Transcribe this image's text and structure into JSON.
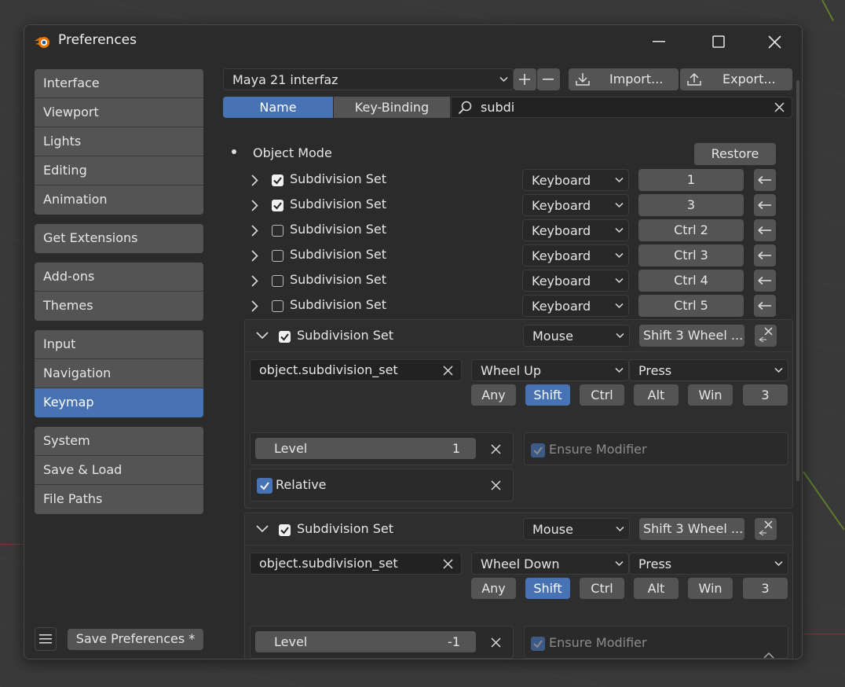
{
  "window": {
    "title": "Preferences"
  },
  "sidebar": {
    "groups": [
      [
        "Interface",
        "Viewport",
        "Lights",
        "Editing",
        "Animation"
      ],
      [
        "Get Extensions"
      ],
      [
        "Add-ons",
        "Themes"
      ],
      [
        "Input",
        "Navigation",
        "Keymap"
      ],
      [
        "System",
        "Save & Load",
        "File Paths"
      ]
    ],
    "active": "Keymap"
  },
  "footer": {
    "save_label": "Save Preferences *"
  },
  "keymap": {
    "preset": "Maya 21 interfaz",
    "import_label": "Import...",
    "export_label": "Export...",
    "tab_name": "Name",
    "tab_keybinding": "Key-Binding",
    "search_value": "subdi",
    "section": "Object Mode",
    "restore_label": "Restore",
    "rows": [
      {
        "name": "Subdivision Set",
        "checked": true,
        "type": "Keyboard",
        "key": "1"
      },
      {
        "name": "Subdivision Set",
        "checked": true,
        "type": "Keyboard",
        "key": "3"
      },
      {
        "name": "Subdivision Set",
        "checked": false,
        "type": "Keyboard",
        "key": "Ctrl 2"
      },
      {
        "name": "Subdivision Set",
        "checked": false,
        "type": "Keyboard",
        "key": "Ctrl 3"
      },
      {
        "name": "Subdivision Set",
        "checked": false,
        "type": "Keyboard",
        "key": "Ctrl 4"
      },
      {
        "name": "Subdivision Set",
        "checked": false,
        "type": "Keyboard",
        "key": "Ctrl 5"
      }
    ],
    "expanded": [
      {
        "name": "Subdivision Set",
        "type": "Mouse",
        "key": "Shift 3 Wheel ...",
        "operator": "object.subdivision_set",
        "event": "Wheel Up",
        "action": "Press",
        "modifiers": [
          "Any",
          "Shift",
          "Ctrl",
          "Alt",
          "Win",
          "3"
        ],
        "level_label": "Level",
        "level_value": "1",
        "relative_label": "Relative",
        "ensure_label": "Ensure Modifier"
      },
      {
        "name": "Subdivision Set",
        "type": "Mouse",
        "key": "Shift 3 Wheel ...",
        "operator": "object.subdivision_set",
        "event": "Wheel Down",
        "action": "Press",
        "modifiers": [
          "Any",
          "Shift",
          "Ctrl",
          "Alt",
          "Win",
          "3"
        ],
        "level_label": "Level",
        "level_value": "-1",
        "ensure_label": "Ensure Modifier"
      }
    ]
  }
}
